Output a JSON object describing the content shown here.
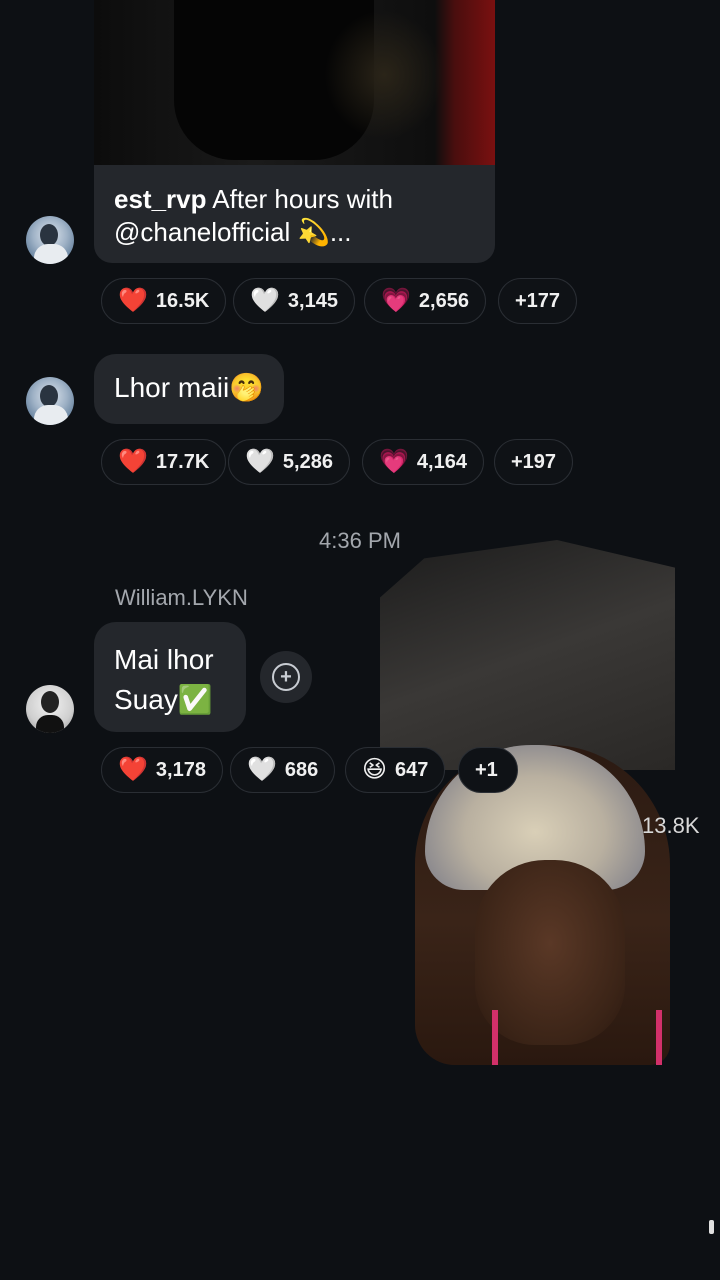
{
  "messages": [
    {
      "caption_user": "est_rvp",
      "caption_text": "After hours with @chanelofficial 💫...",
      "reactions": [
        {
          "emoji": "❤️",
          "count": "16.5K"
        },
        {
          "emoji": "🤍",
          "count": "3,145"
        },
        {
          "emoji": "💗",
          "count": "2,656"
        },
        {
          "emoji": "",
          "count": "+177"
        }
      ]
    },
    {
      "text": "Lhor maii🤭",
      "reactions": [
        {
          "emoji": "❤️",
          "count": "17.7K"
        },
        {
          "emoji": "🤍",
          "count": "5,286"
        },
        {
          "emoji": "💗",
          "count": "4,164"
        },
        {
          "emoji": "",
          "count": "+197"
        }
      ]
    },
    {
      "timestamp": "4:36 PM",
      "sender": "William.LYKN",
      "text_line1": "Mai lhor",
      "text_line2": "Suay✅",
      "reactions": [
        {
          "emoji": "❤️",
          "count": "3,178"
        },
        {
          "emoji": "🤍",
          "count": "686"
        },
        {
          "emoji": "😆",
          "count": "647"
        },
        {
          "emoji": "",
          "count": "+1"
        }
      ]
    }
  ],
  "overlay_count": "13.8K",
  "icons": {
    "add_reaction": "add-reaction-icon"
  }
}
